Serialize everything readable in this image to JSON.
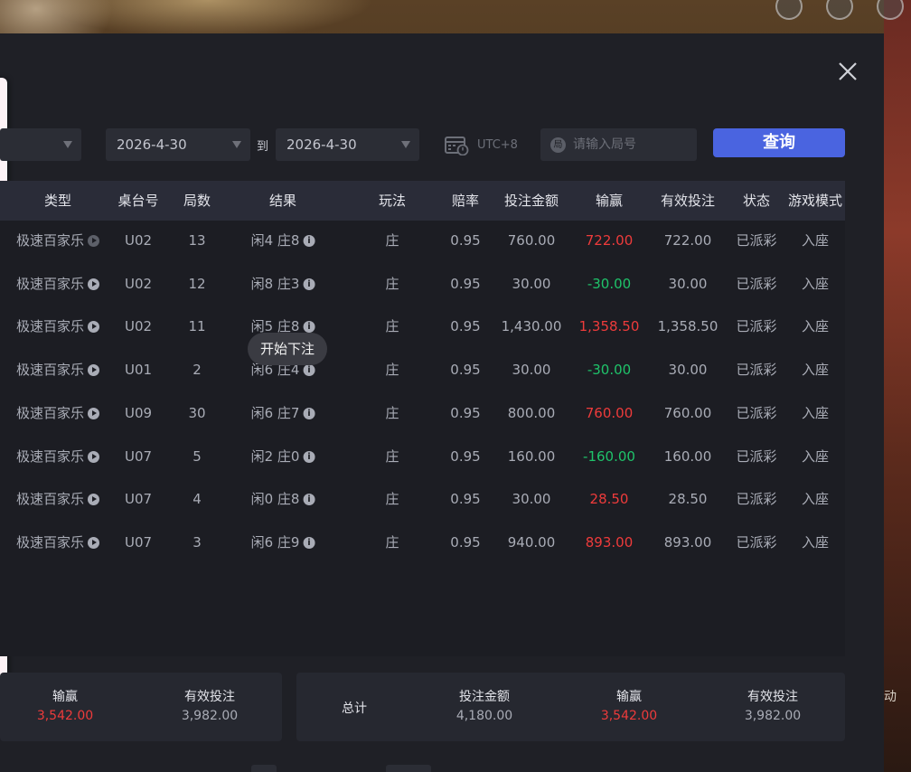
{
  "side_label": "动",
  "filters": {
    "date_from": "2026-4-30",
    "to_label": "到",
    "date_to": "2026-4-30",
    "timezone": "UTC+8",
    "round_placeholder": "请输入局号",
    "round_icon": "局",
    "query_label": "查询"
  },
  "table": {
    "headers": [
      "类型",
      "桌台号",
      "局数",
      "结果",
      "玩法",
      "赔率",
      "投注金额",
      "输赢",
      "有效投注",
      "状态",
      "游戏模式"
    ],
    "rows": [
      {
        "type": "极速百家乐",
        "table": "U02",
        "round": "13",
        "result": "闲4 庄8",
        "play": "庄",
        "odds": "0.95",
        "bet": "760.00",
        "winloss": "722.00",
        "sign": "pos",
        "valid": "722.00",
        "status": "已派彩",
        "mode": "入座"
      },
      {
        "type": "极速百家乐",
        "table": "U02",
        "round": "12",
        "result": "闲8 庄3",
        "play": "庄",
        "odds": "0.95",
        "bet": "30.00",
        "winloss": "-30.00",
        "sign": "neg",
        "valid": "30.00",
        "status": "已派彩",
        "mode": "入座"
      },
      {
        "type": "极速百家乐",
        "table": "U02",
        "round": "11",
        "result": "闲5 庄8",
        "play": "庄",
        "odds": "0.95",
        "bet": "1,430.00",
        "winloss": "1,358.50",
        "sign": "pos",
        "valid": "1,358.50",
        "status": "已派彩",
        "mode": "入座"
      },
      {
        "type": "极速百家乐",
        "table": "U01",
        "round": "2",
        "result": "闲6 庄4",
        "play": "庄",
        "odds": "0.95",
        "bet": "30.00",
        "winloss": "-30.00",
        "sign": "neg",
        "valid": "30.00",
        "status": "已派彩",
        "mode": "入座"
      },
      {
        "type": "极速百家乐",
        "table": "U09",
        "round": "30",
        "result": "闲6 庄7",
        "play": "庄",
        "odds": "0.95",
        "bet": "800.00",
        "winloss": "760.00",
        "sign": "pos",
        "valid": "760.00",
        "status": "已派彩",
        "mode": "入座"
      },
      {
        "type": "极速百家乐",
        "table": "U07",
        "round": "5",
        "result": "闲2 庄0",
        "play": "庄",
        "odds": "0.95",
        "bet": "160.00",
        "winloss": "-160.00",
        "sign": "neg",
        "valid": "160.00",
        "status": "已派彩",
        "mode": "入座"
      },
      {
        "type": "极速百家乐",
        "table": "U07",
        "round": "4",
        "result": "闲0 庄8",
        "play": "庄",
        "odds": "0.95",
        "bet": "30.00",
        "winloss": "28.50",
        "sign": "pos",
        "valid": "28.50",
        "status": "已派彩",
        "mode": "入座"
      },
      {
        "type": "极速百家乐",
        "table": "U07",
        "round": "3",
        "result": "闲6 庄9",
        "play": "庄",
        "odds": "0.95",
        "bet": "940.00",
        "winloss": "893.00",
        "sign": "pos",
        "valid": "893.00",
        "status": "已派彩",
        "mode": "入座"
      }
    ]
  },
  "tooltip": "开始下注",
  "page_summary": {
    "winloss_label": "输赢",
    "winloss_value": "3,542.00",
    "valid_label": "有效投注",
    "valid_value": "3,982.00"
  },
  "total_summary": {
    "total_label": "总计",
    "bet_label": "投注金额",
    "bet_value": "4,180.00",
    "winloss_label": "输赢",
    "winloss_value": "3,542.00",
    "valid_label": "有效投注",
    "valid_value": "3,982.00"
  },
  "colors": {
    "positive": "#ee3b3b",
    "negative": "#1fc36a",
    "accent": "#4a64e0"
  }
}
